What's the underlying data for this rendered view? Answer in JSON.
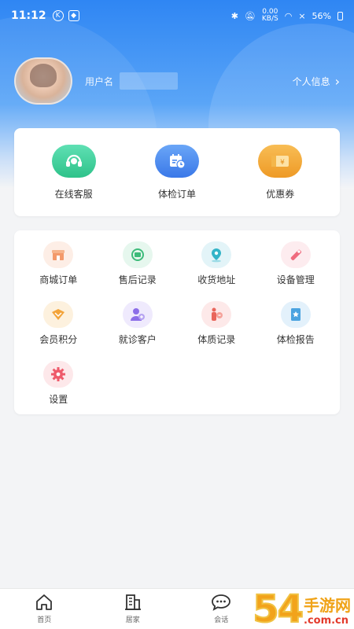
{
  "status_bar": {
    "time": "11:12",
    "net_speed": "0.00",
    "net_unit": "KB/S",
    "battery": "56%"
  },
  "profile": {
    "username_label": "用户名",
    "info_link": "个人信息"
  },
  "quick_actions": [
    {
      "label": "在线客服",
      "icon": "headset-icon",
      "color": "#3ecf9b"
    },
    {
      "label": "体检订单",
      "icon": "calendar-clock-icon",
      "color": "#4a8af0"
    },
    {
      "label": "优惠券",
      "icon": "coupon-icon",
      "color": "#f2a43a"
    }
  ],
  "services": [
    {
      "label": "商城订单",
      "icon": "shop-icon"
    },
    {
      "label": "售后记录",
      "icon": "refresh-icon"
    },
    {
      "label": "收货地址",
      "icon": "location-icon"
    },
    {
      "label": "设备管理",
      "icon": "device-icon"
    },
    {
      "label": "会员积分",
      "icon": "points-icon"
    },
    {
      "label": "就诊客户",
      "icon": "patient-icon"
    },
    {
      "label": "体质记录",
      "icon": "body-record-icon"
    },
    {
      "label": "体检报告",
      "icon": "report-icon"
    },
    {
      "label": "设置",
      "icon": "gear-icon"
    }
  ],
  "tabbar": [
    {
      "label": "首页",
      "icon": "home-icon"
    },
    {
      "label": "居家",
      "icon": "building-icon"
    },
    {
      "label": "会话",
      "icon": "chat-icon"
    }
  ],
  "watermark": {
    "number": "54",
    "text_top": "手游网",
    "text_bottom": ".com.cn"
  },
  "colors": {
    "header_blue": "#2f86f3",
    "background": "#f3f4f6"
  }
}
